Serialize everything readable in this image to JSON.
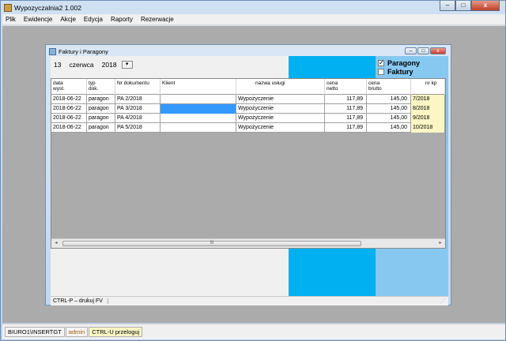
{
  "app": {
    "title": "Wypozyczalnia2 1.002",
    "controls": {
      "minimize": "–",
      "maximize": "□",
      "close": "x"
    }
  },
  "menu": [
    "Plik",
    "Ewidencje",
    "Akcje",
    "Edycja",
    "Raporty",
    "Rezerwacje"
  ],
  "child": {
    "title": "Faktury i Paragony",
    "controls": {
      "minimize": "–",
      "maximize": "□",
      "close": "x"
    },
    "date": {
      "day": "13",
      "month": "czerwca",
      "year": "2018"
    },
    "checkboxes": [
      {
        "label": "Paragony",
        "checked": true,
        "mark": "✓"
      },
      {
        "label": "Faktury",
        "checked": false,
        "mark": ""
      }
    ],
    "grid": {
      "headers": [
        [
          "data",
          "wyst."
        ],
        [
          "typ",
          "dok."
        ],
        [
          "Nr dokumentu",
          ""
        ],
        [
          "Klient",
          ""
        ],
        [
          "nazwa usługi",
          ""
        ],
        [
          "cena",
          "netto"
        ],
        [
          "cena",
          "brutto"
        ],
        [
          "nr kp",
          ""
        ]
      ],
      "rows": [
        [
          "2018-06-22",
          "paragon",
          "PA 2/2018",
          "",
          "Wypożyczenie",
          "117,89",
          "145,00",
          "7/2018"
        ],
        [
          "2018-06-22",
          "paragon",
          "PA 3/2018",
          "",
          "Wypożyczenie",
          "117,89",
          "145,00",
          "8/2018"
        ],
        [
          "2018-06-22",
          "paragon",
          "PA 4/2018",
          "",
          "Wypożyczenie",
          "117,89",
          "145,00",
          "9/2018"
        ],
        [
          "2018-06-22",
          "paragon",
          "PA 5/2018",
          "",
          "Wypożyczenie",
          "117,89",
          "145,00",
          "10/2018"
        ]
      ],
      "scroll": {
        "left": "◂",
        "right": "▸",
        "grip": "III"
      }
    },
    "status": "CTRL-P – drukuj FV"
  },
  "statusbar": [
    "BIURO1\\INSERTGT",
    "admin",
    "CTRL-U przeloguj"
  ]
}
